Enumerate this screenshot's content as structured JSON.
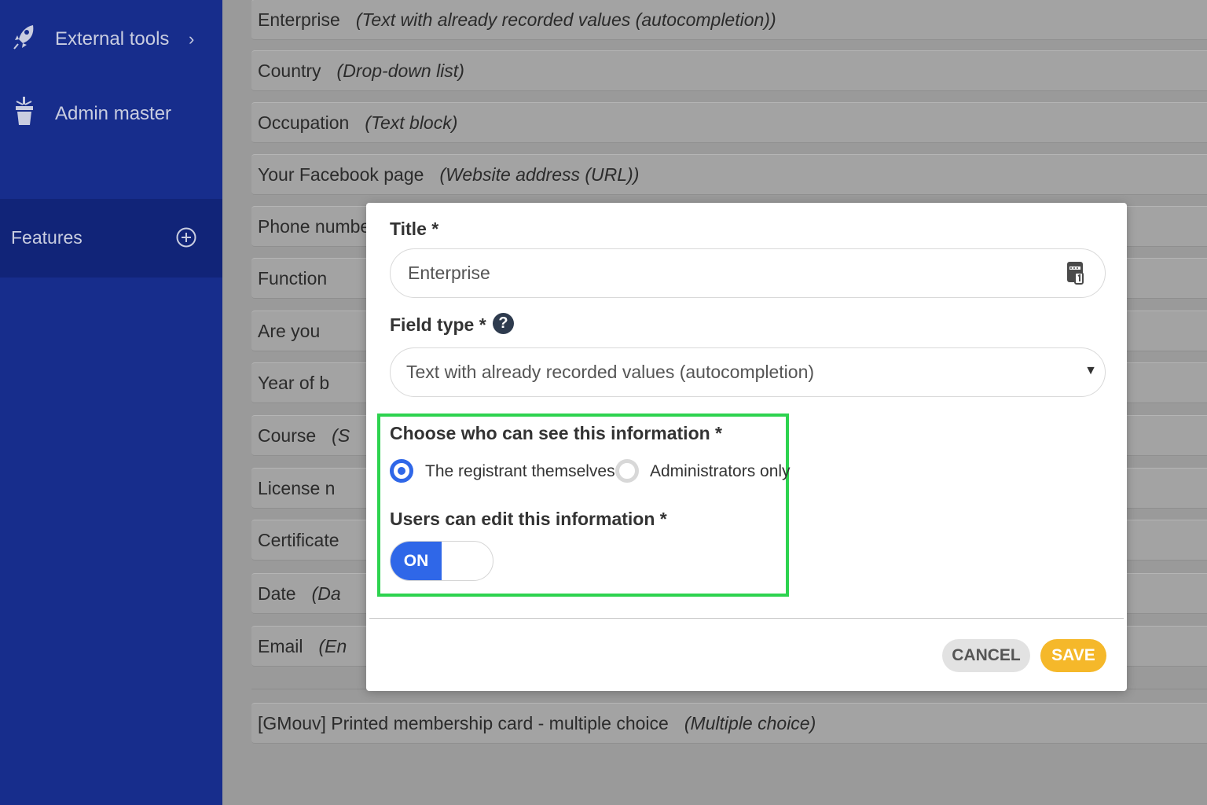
{
  "sidebar": {
    "items": [
      {
        "label": "External tools",
        "icon": "rocket-icon"
      },
      {
        "label": "Admin master",
        "icon": "trophy-icon"
      }
    ],
    "features": {
      "label": "Features",
      "icon": "plus-circle-icon"
    }
  },
  "list": {
    "rows": [
      {
        "name": "Enterprise",
        "type": "(Text with already recorded values (autocompletion))"
      },
      {
        "name": "Country",
        "type": "(Drop-down list)"
      },
      {
        "name": "Occupation",
        "type": "(Text block)"
      },
      {
        "name": "Your Facebook page",
        "type": "(Website address (URL))"
      },
      {
        "name": "Phone number",
        "type": ""
      },
      {
        "name": "Function",
        "type": ""
      },
      {
        "name": "Are you",
        "type": ""
      },
      {
        "name": "Year of b",
        "type": ""
      },
      {
        "name": "Course",
        "type": "(S"
      },
      {
        "name": "License n",
        "type": ""
      },
      {
        "name": "Certificate",
        "type": ""
      },
      {
        "name": "Date",
        "type": "(Da"
      },
      {
        "name": "Email",
        "type": "(En"
      },
      {
        "name": "[GMouv] Printed membership card - multiple choice",
        "type": "(Multiple choice)"
      }
    ]
  },
  "modal": {
    "title_label": "Title *",
    "title_value": "Enterprise",
    "field_type_label": "Field type *",
    "help_symbol": "?",
    "field_type_value": "Text with already recorded values (autocompletion)",
    "visibility_label": "Choose who can see this information *",
    "visibility_options": [
      "The registrant themselves",
      "Administrators only"
    ],
    "visibility_selected": "The registrant themselves",
    "edit_label": "Users can edit this information *",
    "toggle_label": "ON",
    "cancel_label": "CANCEL",
    "save_label": "SAVE"
  },
  "colors": {
    "sidebar": "#172d8c",
    "accent": "#2f67e8",
    "save": "#f5b82a",
    "highlight": "#2dd34f"
  }
}
